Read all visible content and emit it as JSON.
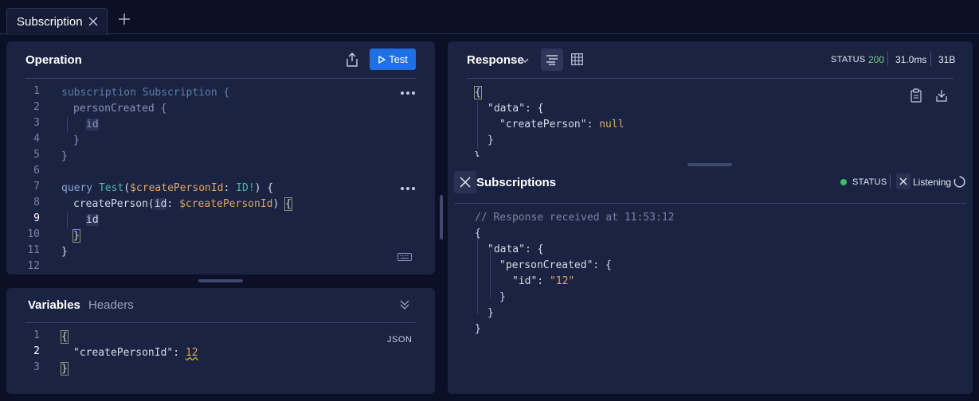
{
  "tabs": {
    "active": "Subscription"
  },
  "operation": {
    "title": "Operation",
    "test_label": "Test",
    "line_numbers": [
      "1",
      "2",
      "3",
      "4",
      "5",
      "6",
      "7",
      "8",
      "9",
      "10",
      "11",
      "12"
    ]
  },
  "variables": {
    "tab_variables": "Variables",
    "tab_headers": "Headers",
    "format": "JSON",
    "line_numbers": [
      "1",
      "2",
      "3"
    ]
  },
  "response": {
    "title": "Response",
    "status_label": "STATUS",
    "status_code": "200",
    "time": "31.0ms",
    "size": "31B"
  },
  "subscriptions": {
    "title": "Subscriptions",
    "status_label": "STATUS",
    "listening": "Listening",
    "comment": "// Response received at 11:53:12"
  },
  "colors": {
    "accent": "#1f6fe5",
    "status_ok": "#6fcf7f",
    "bg": "#0b1026",
    "panel": "#1b2342"
  }
}
